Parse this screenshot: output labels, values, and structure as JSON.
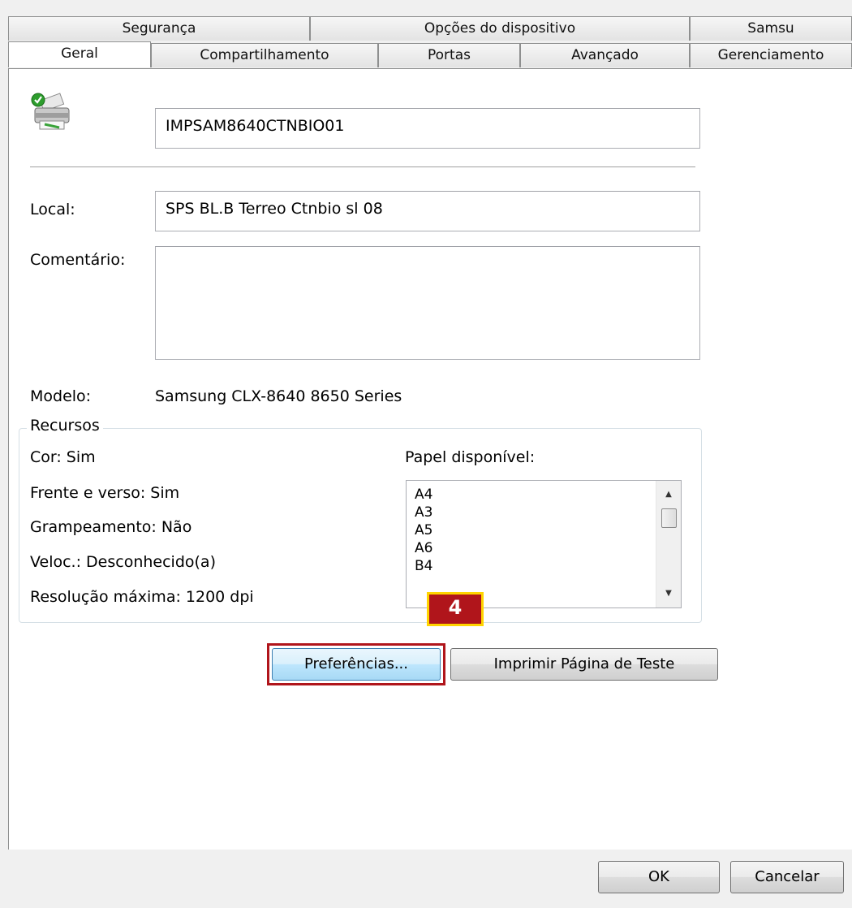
{
  "tabs_back": [
    "Segurança",
    "Opções do dispositivo",
    "Samsu"
  ],
  "tabs_front": [
    "Geral",
    "Compartilhamento",
    "Portas",
    "Avançado",
    "Gerenciamento"
  ],
  "printer_name": "IMPSAM8640CTNBIO01",
  "location": {
    "label": "Local:",
    "value": "SPS BL.B Terreo Ctnbio sl 08"
  },
  "comment": {
    "label": "Comentário:",
    "value": ""
  },
  "model": {
    "label": "Modelo:",
    "value": "Samsung CLX-8640 8650 Series"
  },
  "features": {
    "title": "Recursos",
    "color": "Cor: Sim",
    "duplex": "Frente e verso: Sim",
    "stapling": "Grampeamento: Não",
    "speed": "Veloc.: Desconhecido(a)",
    "max_resolution": "Resolução máxima: 1200 dpi",
    "paper_label": "Papel disponível:",
    "paper_options": [
      "A4",
      "A3",
      "A5",
      "A6",
      "B4"
    ]
  },
  "callout_number": "4",
  "buttons": {
    "preferences": "Preferências...",
    "print_test": "Imprimir Página de Teste",
    "ok": "OK",
    "cancel": "Cancelar"
  },
  "highlight_color": "#b0151b",
  "callout_border_color": "#ffd400"
}
